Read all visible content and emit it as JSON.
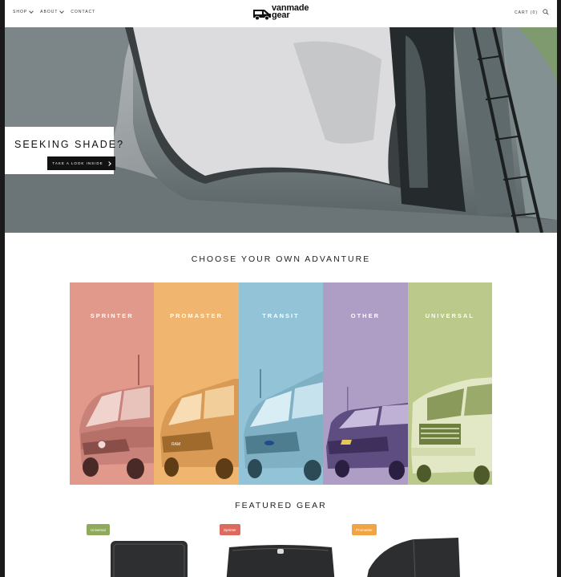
{
  "nav": {
    "shop": "SHOP",
    "about": "ABOUT",
    "contact": "CONTACT",
    "cart": "CART (0)"
  },
  "logo": {
    "line1": "vanmade",
    "line2": "gear"
  },
  "hero": {
    "title": "SEEKING SHADE?",
    "button": "TAKE A LOOK INSIDE"
  },
  "sections": {
    "choose": "CHOOSE YOUR OWN ADVANTURE",
    "featured": "FEATURED GEAR"
  },
  "categories": [
    {
      "label": "SPRINTER",
      "color": "#e0998a"
    },
    {
      "label": "PROMASTER",
      "color": "#f0b56f"
    },
    {
      "label": "TRANSIT",
      "color": "#92c3d7"
    },
    {
      "label": "OTHER",
      "color": "#ae9ec5"
    },
    {
      "label": "UNIVERSAL",
      "color": "#bbc98a"
    }
  ],
  "featured": [
    {
      "badge": "Universal",
      "badge_color": "#8faa5c"
    },
    {
      "badge": "Sprinter",
      "badge_color": "#dc6a5e"
    },
    {
      "badge": "Promaster",
      "badge_color": "#f0a444"
    }
  ]
}
